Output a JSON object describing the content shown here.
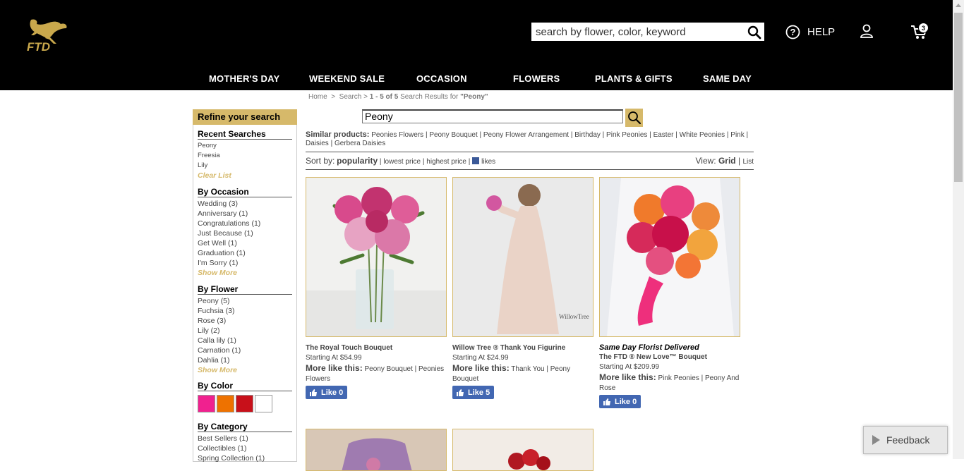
{
  "header": {
    "logo_text": "FTD",
    "search_placeholder": "search by flower, color, keyword",
    "help_label": "HELP",
    "cart_count": "3"
  },
  "nav": [
    {
      "label": "MOTHER'S DAY"
    },
    {
      "label": "WEEKEND SALE"
    },
    {
      "label": "OCCASION"
    },
    {
      "label": "FLOWERS"
    },
    {
      "label": "PLANTS & GIFTS"
    },
    {
      "label": "SAME DAY"
    }
  ],
  "breadcrumb": {
    "home": "Home",
    "sep": ">",
    "search": "Search",
    "results": "1 - 5 of 5",
    "results_suffix": " Search Results for ",
    "query": "\"Peony\""
  },
  "sidebar": {
    "title": "Refine your search",
    "recent": {
      "heading": "Recent Searches",
      "items": [
        "Peony",
        "Freesia",
        "Lily"
      ],
      "clear": "Clear List"
    },
    "occasion": {
      "heading": "By Occasion",
      "items": [
        "Wedding (3)",
        "Anniversary (1)",
        "Congratulations (1)",
        "Just Because (1)",
        "Get Well (1)",
        "Graduation (1)",
        "I'm Sorry (1)"
      ],
      "more": "Show More"
    },
    "flower": {
      "heading": "By Flower",
      "items": [
        "Peony (5)",
        "Fuchsia (3)",
        "Rose (3)",
        "Lily (2)",
        "Calla lily (1)",
        "Carnation (1)",
        "Dahlia (1)"
      ],
      "more": "Show More"
    },
    "color": {
      "heading": "By Color",
      "swatches": [
        "#f0218f",
        "#ee7200",
        "#c8101a",
        "#ffffff"
      ]
    },
    "category": {
      "heading": "By Category",
      "items": [
        "Best Sellers (1)",
        "Collectibles (1)",
        "Spring Collection (1)"
      ]
    }
  },
  "search": {
    "value": "Peony"
  },
  "similar": {
    "label": "Similar products:",
    "items": [
      "Peonies Flowers",
      "Peony Bouquet",
      "Peony Flower Arrangement",
      "Birthday",
      "Pink Peonies",
      "Easter",
      "White Peonies",
      "Pink",
      "Daisies",
      "Gerbera Daisies"
    ]
  },
  "sort": {
    "label": "Sort by:",
    "popularity": "popularity",
    "lowest": "lowest price",
    "highest": "highest price",
    "likes": "likes",
    "view_label": "View:",
    "grid": "Grid",
    "list": "List"
  },
  "products": [
    {
      "promo": "",
      "name": "The Royal Touch Bouquet",
      "price": "Starting At $54.99",
      "more_label": "More like this:",
      "more_links": "Peony Bouquet | Peonies Flowers",
      "likes": "Like 0"
    },
    {
      "promo": "",
      "name": "Willow Tree ® Thank You Figurine",
      "price": "Starting At $24.99",
      "more_label": "More like this:",
      "more_links": "Thank You | Peony Bouquet",
      "likes": "Like 5"
    },
    {
      "promo": "Same Day Florist Delivered",
      "name": "The FTD ® New Love™ Bouquet",
      "price": "Starting At $209.99",
      "more_label": "More like this:",
      "more_links": "Pink Peonies | Peony And Rose",
      "likes": "Like 0"
    }
  ],
  "feedback": {
    "label": "Feedback"
  },
  "colors": {
    "gold": "#d6b96a",
    "facebook": "#4267b2"
  },
  "icons": [
    "ftd-mercury-logo-icon",
    "search-icon",
    "help-icon",
    "user-icon",
    "cart-icon",
    "facebook-icon",
    "thumbs-up-icon",
    "play-icon"
  ]
}
